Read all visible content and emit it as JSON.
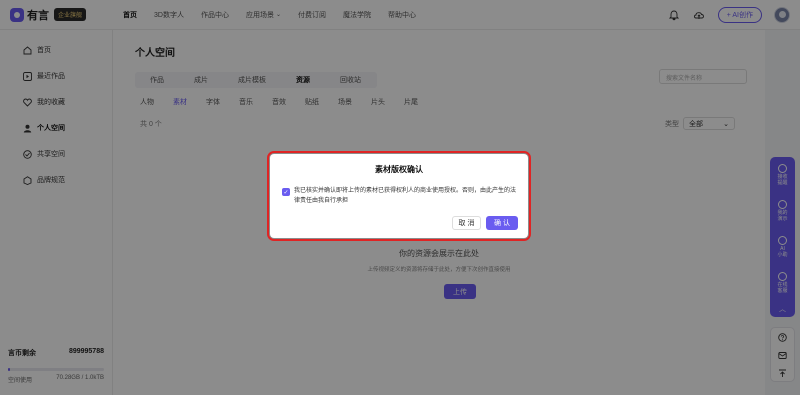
{
  "brand": {
    "logo_text": "有言",
    "badge": "企业旗舰",
    "accent": "#6a5cf0"
  },
  "nav": {
    "items": [
      {
        "label": "首页",
        "active": true
      },
      {
        "label": "3D数字人"
      },
      {
        "label": "作品中心"
      },
      {
        "label": "应用场景",
        "has_dropdown": true
      },
      {
        "label": "付费订阅"
      },
      {
        "label": "魔法学院"
      },
      {
        "label": "帮助中心"
      }
    ],
    "ai_button": "+ AI创作",
    "icons": [
      "bell-icon",
      "cloud-icon"
    ]
  },
  "sidebar": {
    "items": [
      {
        "label": "首页",
        "icon": "home-icon"
      },
      {
        "label": "最近作品",
        "icon": "play-icon"
      },
      {
        "label": "我的收藏",
        "icon": "heart-icon"
      },
      {
        "label": "个人空间",
        "icon": "user-icon",
        "active": true
      },
      {
        "label": "共享空间",
        "icon": "share-icon"
      },
      {
        "label": "品牌规范",
        "icon": "brand-icon"
      }
    ],
    "quota": {
      "coins_label": "言币剩余",
      "coins_value": "899995788",
      "space_label": "空间使用",
      "space_value": "70.28GB / 1.0kTB",
      "usage_fraction": 0.02
    }
  },
  "main": {
    "title": "个人空间",
    "tabs": [
      {
        "label": "作品"
      },
      {
        "label": "成片"
      },
      {
        "label": "成片模板"
      },
      {
        "label": "资源",
        "active": true
      },
      {
        "label": "回收站"
      }
    ],
    "search_placeholder": "搜索文件名称",
    "subtabs": [
      {
        "label": "人物"
      },
      {
        "label": "素材",
        "active": true
      },
      {
        "label": "字体"
      },
      {
        "label": "音乐"
      },
      {
        "label": "音效"
      },
      {
        "label": "贴纸"
      },
      {
        "label": "场景"
      },
      {
        "label": "片头"
      },
      {
        "label": "片尾"
      }
    ],
    "count_text": "共 0 个",
    "sort_label": "类型",
    "sort_value": "全部",
    "empty_title": "你的资源会展示在此处",
    "empty_subtitle": "上传视频定义的资源将存储于此处，方便下次创作直接使用",
    "upload_button": "上传"
  },
  "float_panel": {
    "items": [
      {
        "label": "接收\n提醒",
        "icon": "bell-icon"
      },
      {
        "label": "我的\n演示",
        "icon": "demo-icon"
      },
      {
        "label": "AI\n小助",
        "icon": "robot-icon"
      },
      {
        "label": "在线\n客服",
        "icon": "headset-icon"
      }
    ],
    "collapse": "︿"
  },
  "dialog": {
    "title": "素材版权确认",
    "checked": true,
    "text": "我已核实并确认即将上传的素材已获得权利人的商业使用授权。否则，由此产生的法律责任由我自行承担",
    "cancel": "取 消",
    "confirm": "确 认"
  }
}
